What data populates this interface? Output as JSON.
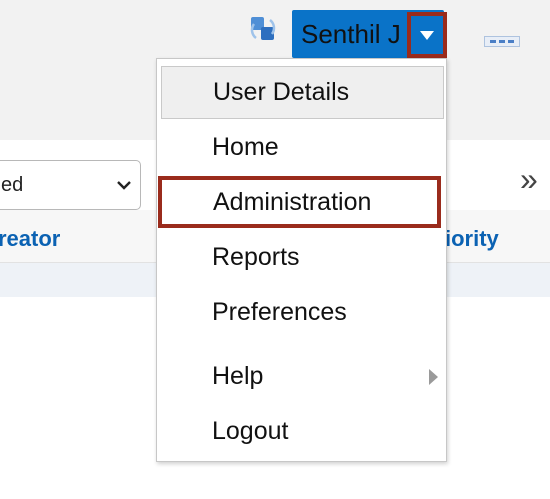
{
  "header": {
    "user_name": "Senthil J",
    "icons": {
      "refresh": "refresh-icon",
      "caret": "caret-down-icon",
      "more": "more-icon"
    },
    "colors": {
      "user_button": "#0a73c8",
      "highlight": "#9a2b1c"
    }
  },
  "filter": {
    "selected_value": "ed"
  },
  "table": {
    "columns": [
      "reator",
      "iority"
    ]
  },
  "user_menu": {
    "items": [
      {
        "label": "User Details"
      },
      {
        "label": "Home"
      },
      {
        "label": "Administration"
      },
      {
        "label": "Reports"
      },
      {
        "label": "Preferences"
      },
      {
        "label": "Help"
      },
      {
        "label": "Logout"
      }
    ]
  }
}
